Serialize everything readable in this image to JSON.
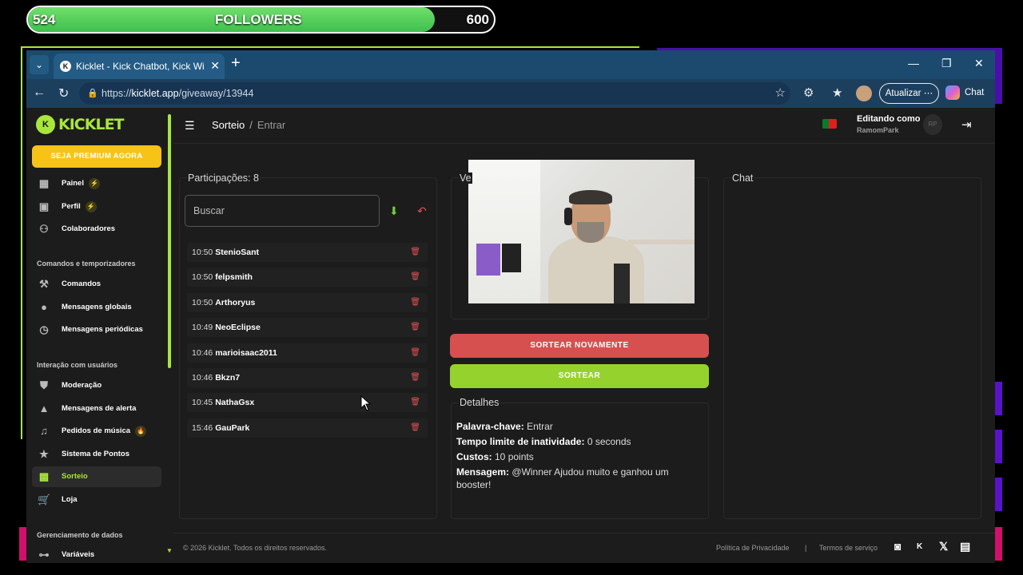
{
  "overlay": {
    "followers_current": "524",
    "followers_label": "FOLLOWERS",
    "followers_goal": "600",
    "progress_fraction": 0.873
  },
  "browser": {
    "tab_title": "Kicklet - Kick Chatbot, Kick Widget",
    "url_prefix": "https://",
    "url_host": "kicklet.app",
    "url_path": "/giveaway/13944",
    "update_label": "Atualizar",
    "chat_label": "Chat"
  },
  "sidebar": {
    "logo_text": "KICKLET",
    "premium_label": "SEJA PREMIUM AGORA",
    "items_top": [
      {
        "label": "Painel",
        "icon": "dashboard-icon"
      },
      {
        "label": "Perfil",
        "icon": "profile-icon"
      },
      {
        "label": "Colaboradores",
        "icon": "collaborators-icon"
      }
    ],
    "section_commands": "Comandos e temporizadores",
    "items_commands": [
      {
        "label": "Comandos",
        "icon": "hammer-icon"
      },
      {
        "label": "Mensagens globais",
        "icon": "chat-bubble-icon"
      },
      {
        "label": "Mensagens periódicas",
        "icon": "clock-icon"
      }
    ],
    "section_interaction": "Interação com usuários",
    "items_interaction": [
      {
        "label": "Moderação",
        "icon": "shield-icon"
      },
      {
        "label": "Mensagens de alerta",
        "icon": "warning-icon"
      },
      {
        "label": "Pedidos de música",
        "icon": "music-icon"
      },
      {
        "label": "Sistema de Pontos",
        "icon": "star-icon"
      },
      {
        "label": "Sorteio",
        "icon": "gift-icon"
      },
      {
        "label": "Loja",
        "icon": "cart-icon"
      }
    ],
    "section_data": "Gerenciamento de dados",
    "items_data": [
      {
        "label": "Variáveis",
        "icon": "variables-icon"
      }
    ]
  },
  "header": {
    "breadcrumb_root": "Sorteio",
    "breadcrumb_sep": "/",
    "breadcrumb_current": "Entrar",
    "editing_as": "Editando como",
    "username": "RamomPark"
  },
  "participants": {
    "title": "Participações: 8",
    "search_placeholder": "Buscar",
    "entries": [
      {
        "time": "10:50",
        "name": "StenioSant"
      },
      {
        "time": "10:50",
        "name": "felpsmith"
      },
      {
        "time": "10:50",
        "name": "Arthoryus"
      },
      {
        "time": "10:49",
        "name": "NeoEclipse"
      },
      {
        "time": "10:46",
        "name": "marioisaac2011"
      },
      {
        "time": "10:46",
        "name": "Bkzn7"
      },
      {
        "time": "10:45",
        "name": "NathaGsx"
      },
      {
        "time": "15:46",
        "name": "GauPark"
      }
    ]
  },
  "winner": {
    "title_fragment": "Ve"
  },
  "actions": {
    "redraw": "SORTEAR NOVAMENTE",
    "draw": "SORTEAR"
  },
  "details": {
    "title": "Detalhes",
    "keyword_label": "Palavra-chave:",
    "keyword_value": " Entrar",
    "timeout_label": "Tempo limite de inatividade:",
    "timeout_value": " 0 seconds",
    "cost_label": "Custos:",
    "cost_value": " 10 points",
    "message_label": "Mensagem:",
    "message_value": " @Winner Ajudou muito e ganhou um booster!"
  },
  "chat": {
    "title": "Chat"
  },
  "footer": {
    "copyright": "© 2026 Kicklet. Todos os direitos reservados.",
    "privacy": "Política de Privacidade",
    "separator": "|",
    "terms": "Termos de serviço"
  },
  "colors": {
    "accent": "#a8e63c",
    "danger": "#d65050",
    "premium": "#f7c317"
  }
}
